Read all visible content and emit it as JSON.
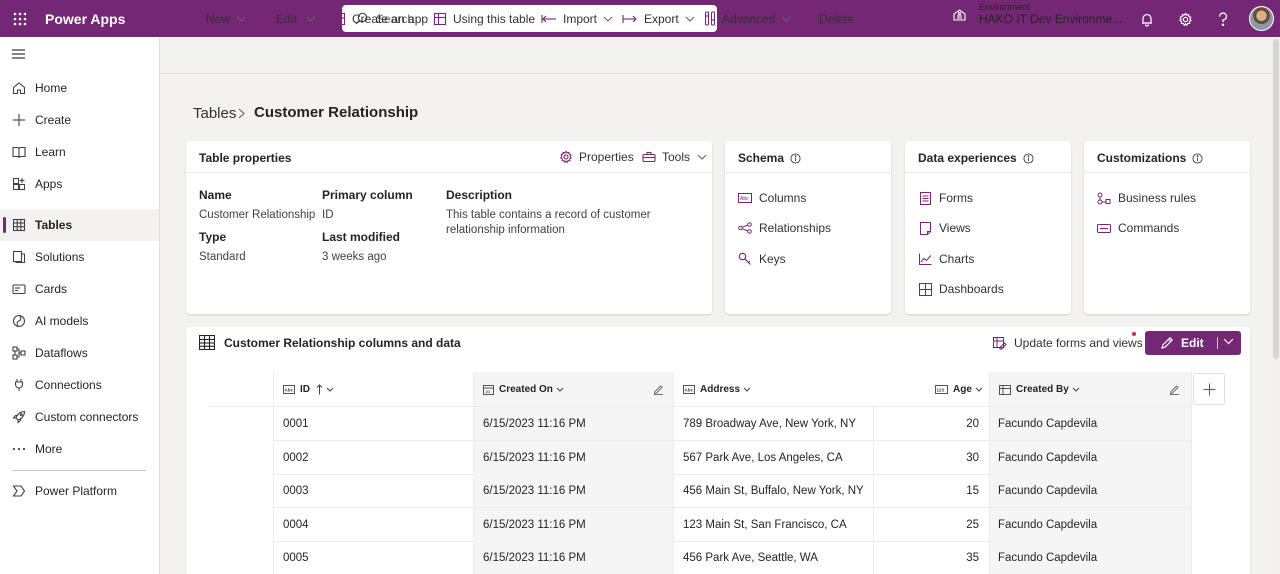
{
  "app": {
    "title": "Power Apps"
  },
  "search": {
    "placeholder": "Search"
  },
  "environment": {
    "label": "Environment",
    "name": "HAKO IT Dev Environme..."
  },
  "sidebar": {
    "items": [
      {
        "label": "Home",
        "icon": "home-icon"
      },
      {
        "label": "Create",
        "icon": "plus-icon"
      },
      {
        "label": "Learn",
        "icon": "book-icon"
      },
      {
        "label": "Apps",
        "icon": "apps-icon"
      },
      {
        "label": "Tables",
        "icon": "table-icon",
        "active": true
      },
      {
        "label": "Solutions",
        "icon": "solutions-icon"
      },
      {
        "label": "Cards",
        "icon": "cards-icon"
      },
      {
        "label": "AI models",
        "icon": "ai-models-icon"
      },
      {
        "label": "Dataflows",
        "icon": "dataflows-icon"
      },
      {
        "label": "Connections",
        "icon": "plug-icon"
      },
      {
        "label": "Custom connectors",
        "icon": "rocket-icon"
      },
      {
        "label": "More",
        "icon": "ellipsis-icon"
      },
      {
        "label": "Power Platform",
        "icon": "power-platform-icon"
      }
    ]
  },
  "commands": {
    "new": "New",
    "edit": "Edit",
    "create_app": "Create an app",
    "using_table": "Using this table",
    "import": "Import",
    "export": "Export",
    "advanced": "Advanced",
    "delete": "Delete"
  },
  "breadcrumb": {
    "root": "Tables",
    "current": "Customer Relationship"
  },
  "table_properties": {
    "title": "Table properties",
    "properties_label": "Properties",
    "tools_label": "Tools",
    "name_label": "Name",
    "name_value": "Customer Relationship",
    "primary_label": "Primary column",
    "primary_value": "ID",
    "description_label": "Description",
    "description_value": "This table contains a record of customer relationship information",
    "type_label": "Type",
    "type_value": "Standard",
    "modified_label": "Last modified",
    "modified_value": "3 weeks ago"
  },
  "schema": {
    "title": "Schema",
    "links": [
      "Columns",
      "Relationships",
      "Keys"
    ]
  },
  "data_experiences": {
    "title": "Data experiences",
    "links": [
      "Forms",
      "Views",
      "Charts",
      "Dashboards"
    ]
  },
  "customizations": {
    "title": "Customizations",
    "links": [
      "Business rules",
      "Commands"
    ]
  },
  "data_panel": {
    "title": "Customer Relationship columns and data",
    "update_label": "Update forms and views",
    "edit_label": "Edit"
  },
  "grid": {
    "columns": [
      "ID",
      "Created On",
      "Address",
      "Age",
      "Created By"
    ],
    "rows": [
      [
        "0001",
        "6/15/2023 11:16 PM",
        "789 Broadway Ave, New York, NY",
        "20",
        "Facundo Capdevila"
      ],
      [
        "0002",
        "6/15/2023 11:16 PM",
        "567 Park Ave, Los Angeles, CA",
        "30",
        "Facundo Capdevila"
      ],
      [
        "0003",
        "6/15/2023 11:16 PM",
        "456 Main St, Buffalo, New York, NY",
        "15",
        "Facundo Capdevila"
      ],
      [
        "0004",
        "6/15/2023 11:16 PM",
        "123 Main St, San Francisco, CA",
        "25",
        "Facundo Capdevila"
      ],
      [
        "0005",
        "6/15/2023 11:16 PM",
        "456 Park Ave, Seattle, WA",
        "35",
        "Facundo Capdevila"
      ]
    ]
  },
  "colors": {
    "brand": "#742774",
    "alert_dot": "#c4314b"
  }
}
